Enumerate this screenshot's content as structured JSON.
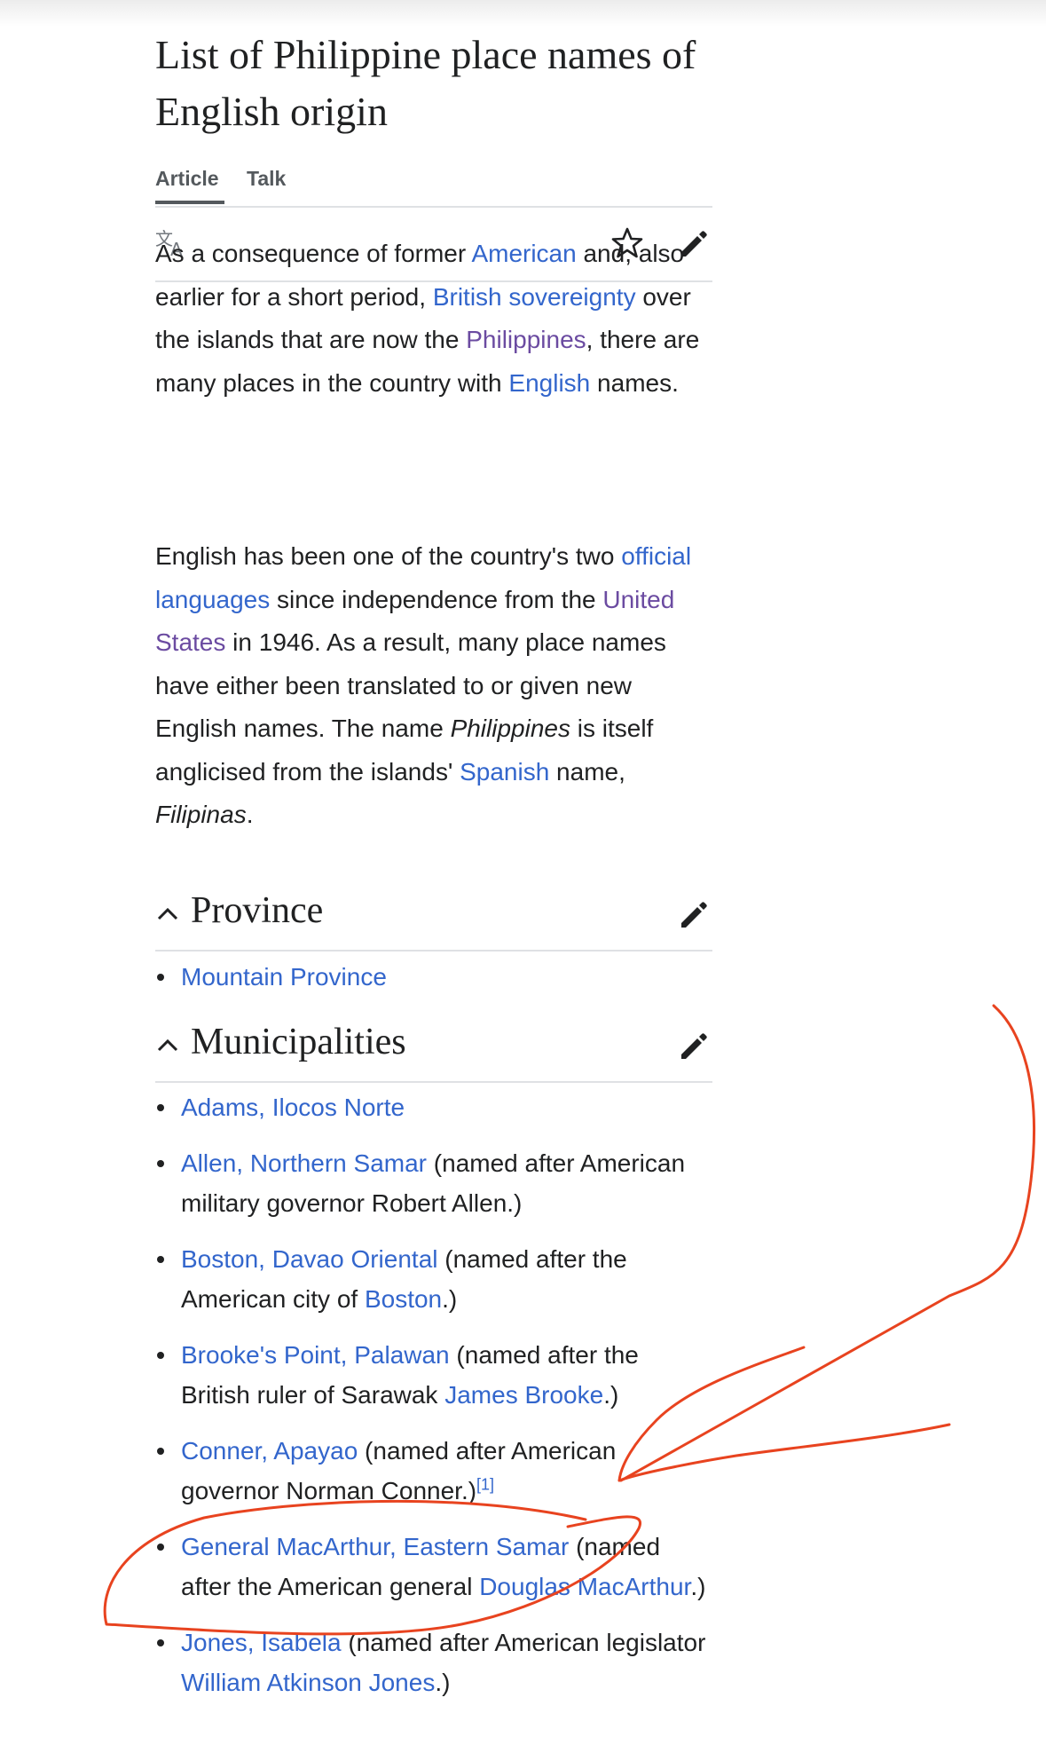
{
  "page": {
    "title": "List of Philippine place names of English origin"
  },
  "tabs": [
    {
      "label": "Article",
      "active": true
    },
    {
      "label": "Talk",
      "active": false
    }
  ],
  "toolbar": {
    "icons": [
      "translate-icon",
      "star-icon",
      "pencil-icon"
    ]
  },
  "intro": {
    "p1": {
      "t1": "As a consequence of former ",
      "l1": "American",
      "t2": " and, also earlier for a short period, ",
      "l2": "British sovereignty",
      "t3": " over the islands that are now the ",
      "l3": "Philippines",
      "t4": ", there are many places in the country with ",
      "l4": "English",
      "t5": " names."
    },
    "p2": {
      "t1": "English has been one of the country's two ",
      "l1": "official languages",
      "t2": " since independence from the ",
      "l2": "United States",
      "t3": " in 1946. As a result, many place names have either been translated to or given new English names. The name ",
      "i1": "Philippines",
      "t4": " is itself anglicised from the islands' ",
      "l3": "Spanish",
      "t5": " name, ",
      "i2": "Filipinas",
      "t6": "."
    }
  },
  "sections": {
    "province": {
      "title": "Province",
      "items": [
        {
          "link": "Mountain Province"
        }
      ]
    },
    "municipalities": {
      "title": "Municipalities",
      "items": [
        {
          "link": "Adams, Ilocos Norte"
        },
        {
          "link": "Allen, Northern Samar",
          "text": " (named after American military governor Robert Allen.)"
        },
        {
          "link": "Boston, Davao Oriental",
          "text": " (named after the American city of ",
          "link2": "Boston",
          "text2": ".)"
        },
        {
          "link": "Brooke's Point, Palawan",
          "text": " (named after the British ruler of Sarawak ",
          "link2": "James Brooke",
          "text2": ".)"
        },
        {
          "link": "Conner, Apayao",
          "text": " (named after American governor Norman Conner.)",
          "ref": "[1]"
        },
        {
          "link": "General MacArthur, Eastern Samar",
          "text": " (named after the American general ",
          "link2": "Douglas MacArthur",
          "text2": ".)"
        },
        {
          "link": "Jones, Isabela",
          "text": " (named after American legislator ",
          "link2": "William Atkinson Jones",
          "text2": ".)"
        }
      ]
    }
  },
  "colors": {
    "link": "#3366cc",
    "visited_link": "#6b4ba1",
    "text": "#202122",
    "annotation": "#e8431f"
  }
}
